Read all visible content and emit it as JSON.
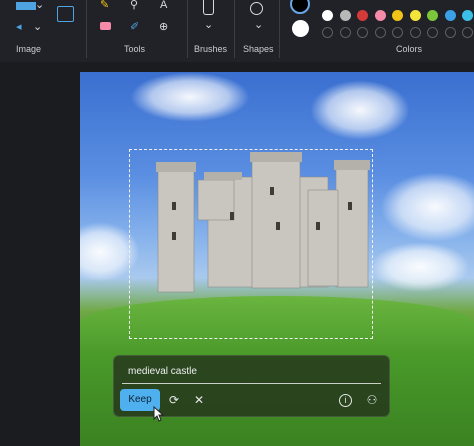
{
  "ribbon": {
    "groups": [
      {
        "label": "Image"
      },
      {
        "label": "Tools"
      },
      {
        "label": "Brushes"
      },
      {
        "label": "Shapes"
      },
      {
        "label": "Colors"
      }
    ]
  },
  "colors": {
    "row1": [
      "#ffffff",
      "#b8b8b8",
      "#d43a3a",
      "#f58ba8",
      "#f2c418",
      "#f2e43a",
      "#7cc63a",
      "#3aa0e8",
      "#3abfe8"
    ],
    "row2": [
      "",
      "",
      "",
      "",
      "",
      "",
      "",
      "",
      ""
    ],
    "primary": "#000000",
    "secondary": "#ffffff"
  },
  "prompt": {
    "text": "medieval castle",
    "keep_label": "Keep"
  }
}
